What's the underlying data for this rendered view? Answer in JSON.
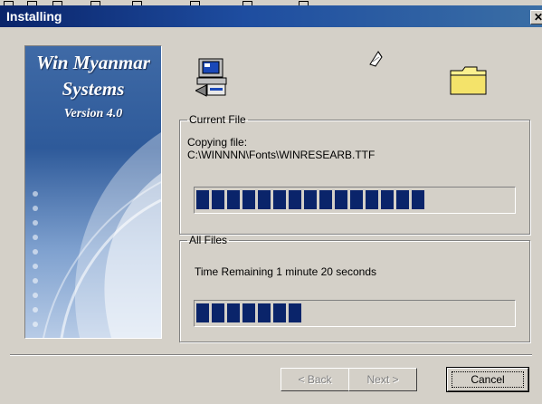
{
  "window": {
    "title": "Installing",
    "close_glyph": "✕"
  },
  "banner": {
    "line1": "Win Myanmar",
    "line2": "Systems",
    "line3": "Version 4.0"
  },
  "icons": [
    "computer-setup-icon",
    "flying-paper-icon",
    "folder-icon"
  ],
  "current_file": {
    "legend": "Current File",
    "label": "Copying file:",
    "path": "C:\\WINNNN\\Fonts\\WINRESEARB.TTF",
    "progress": 0.75
  },
  "all_files": {
    "legend": "All Files",
    "time_remaining": "Time Remaining 1 minute  20 seconds",
    "progress": 0.35
  },
  "buttons": {
    "back": "< Back",
    "next": "Next >",
    "cancel": "Cancel"
  }
}
